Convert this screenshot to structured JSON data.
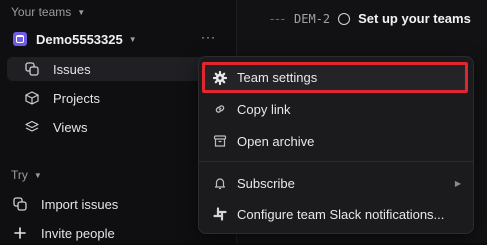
{
  "sidebar": {
    "your_teams_label": "Your teams",
    "team_name": "Demo5553325",
    "team_more": "···",
    "items": [
      {
        "label": "Issues",
        "icon": "issues-icon"
      },
      {
        "label": "Projects",
        "icon": "projects-icon"
      },
      {
        "label": "Views",
        "icon": "views-icon"
      }
    ],
    "try_label": "Try",
    "try_items": [
      {
        "label": "Import issues",
        "icon": "import-icon"
      },
      {
        "label": "Invite people",
        "icon": "plus-icon"
      }
    ]
  },
  "main": {
    "dashes": "---",
    "issue_id": "DEM-2",
    "issue_title": "Set up your teams"
  },
  "menu": {
    "items": [
      {
        "label": "Team settings",
        "icon": "gear-icon",
        "highlighted": true
      },
      {
        "label": "Copy link",
        "icon": "link-icon"
      },
      {
        "label": "Open archive",
        "icon": "archive-icon"
      },
      {
        "label": "Subscribe",
        "icon": "bell-icon",
        "submenu": true
      },
      {
        "label": "Configure team Slack notifications...",
        "icon": "slack-icon"
      }
    ]
  },
  "colors": {
    "highlight_border": "#e0262e",
    "team_avatar": "#6c5ce7"
  }
}
